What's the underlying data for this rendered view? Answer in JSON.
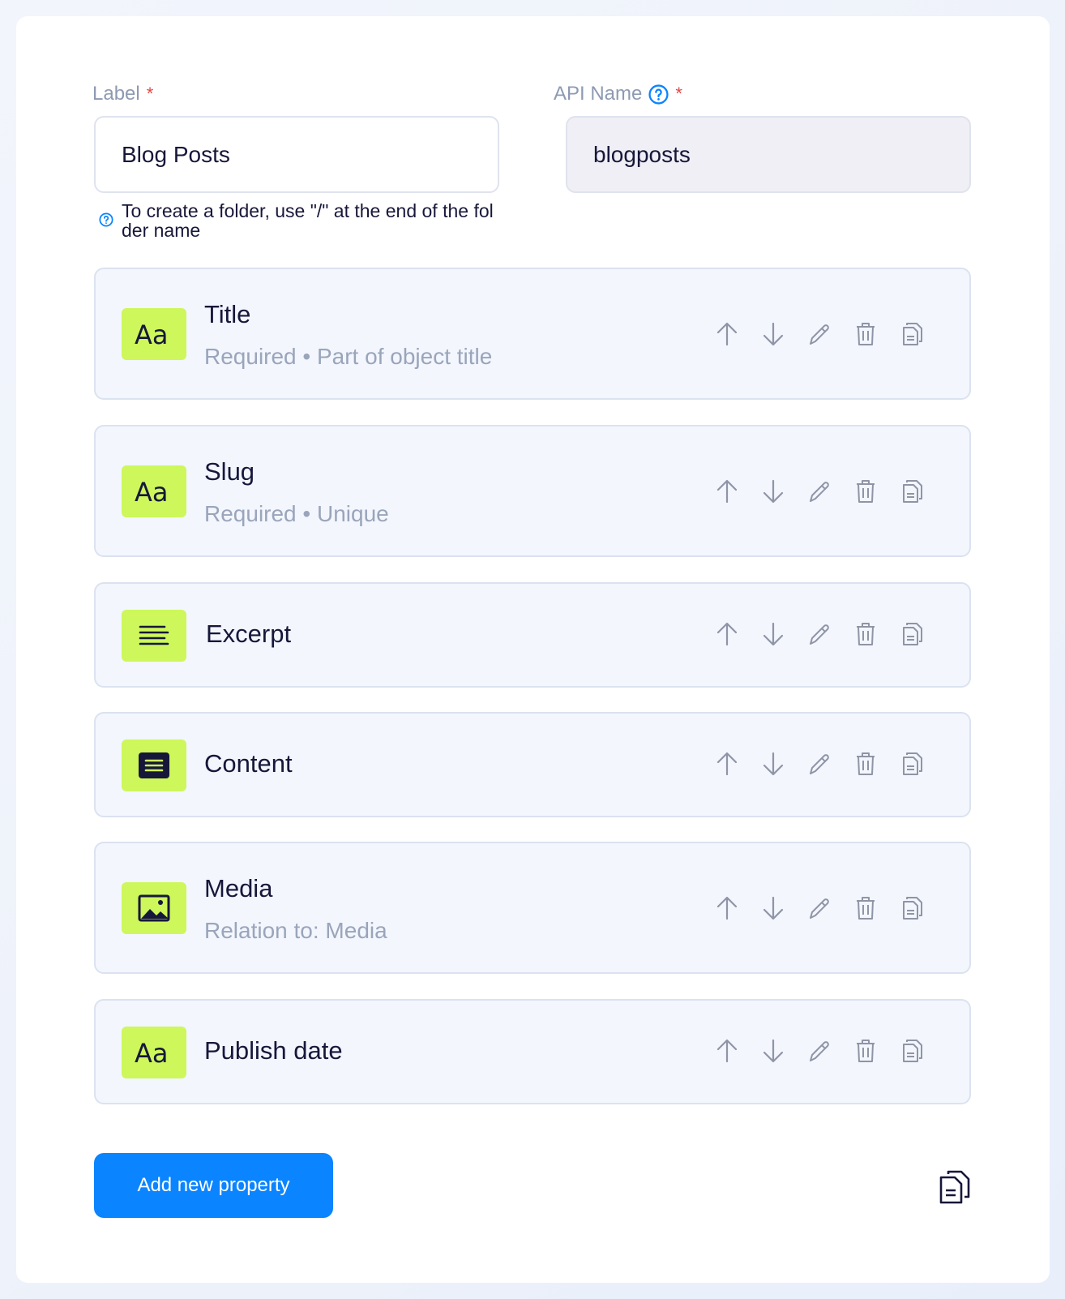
{
  "form": {
    "label_field": {
      "label": "Label",
      "required_mark": "*",
      "value": "Blog Posts"
    },
    "api_field": {
      "label": "API Name",
      "required_mark": "*",
      "value": "blogposts"
    },
    "hint": "To create a folder, use \"/\" at the end of the folder name"
  },
  "properties": [
    {
      "name": "Title",
      "subtitle": "Required • Part of object title",
      "icon": "text-type-icon"
    },
    {
      "name": "Slug",
      "subtitle": "Required • Unique",
      "icon": "text-type-icon"
    },
    {
      "name": "Excerpt",
      "subtitle": "",
      "icon": "align-left-icon"
    },
    {
      "name": "Content",
      "subtitle": "",
      "icon": "rich-text-icon"
    },
    {
      "name": "Media",
      "subtitle": "Relation to: Media",
      "icon": "image-icon"
    },
    {
      "name": "Publish date",
      "subtitle": "",
      "icon": "text-type-icon"
    }
  ],
  "add_button": {
    "label": "Add new property"
  },
  "colors": {
    "accent": "#0a84ff",
    "icon_bg": "#cdf75b",
    "card_bg": "#f3f6fd",
    "muted_text": "#9aa5bb",
    "required": "#e04848"
  }
}
